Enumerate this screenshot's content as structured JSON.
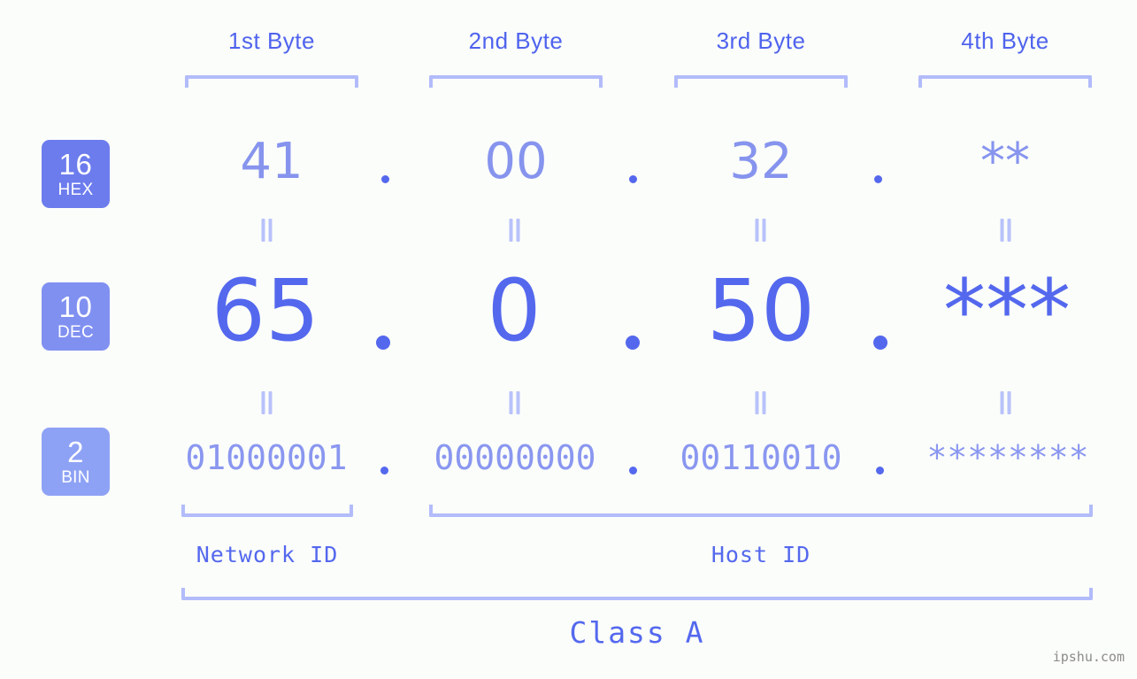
{
  "background_color": "#fbfdfa",
  "accent_color": "#5468ee",
  "accent_light_color": "#8694ee",
  "bracket_color": "#b2bcfb",
  "byte_headers": [
    {
      "label": "1st Byte"
    },
    {
      "label": "2nd Byte"
    },
    {
      "label": "3rd Byte"
    },
    {
      "label": "4th Byte"
    }
  ],
  "bases": [
    {
      "num": "16",
      "abbr": "HEX",
      "badge_color": "#6c7ced"
    },
    {
      "num": "10",
      "abbr": "DEC",
      "badge_color": "#8090f1"
    },
    {
      "num": "2",
      "abbr": "BIN",
      "badge_color": "#8ea2f5"
    }
  ],
  "rows": {
    "hex": {
      "values": [
        "41",
        "00",
        "32",
        "**"
      ],
      "separator": "."
    },
    "dec": {
      "values": [
        "65",
        "0",
        "50",
        "***"
      ],
      "separator": "."
    },
    "bin": {
      "values": [
        "01000001",
        "00000000",
        "00110010",
        "********"
      ],
      "separator": "."
    }
  },
  "equal_marks": {
    "glyph": "||",
    "count_per_gap": 4
  },
  "segments": {
    "network_id": "Network ID",
    "host_id": "Host ID"
  },
  "class_label": "Class A",
  "watermark": "ipshu.com"
}
